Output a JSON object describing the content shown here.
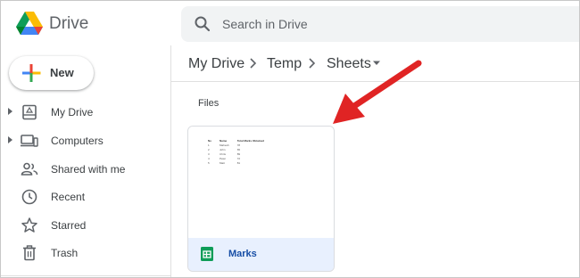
{
  "app": {
    "name": "Drive"
  },
  "search": {
    "placeholder": "Search in Drive"
  },
  "new_button": {
    "label": "New"
  },
  "sidebar": {
    "items": [
      {
        "label": "My Drive",
        "icon": "my-drive-icon",
        "expandable": true
      },
      {
        "label": "Computers",
        "icon": "computer-icon",
        "expandable": true
      },
      {
        "label": "Shared with me",
        "icon": "people-icon",
        "expandable": false
      },
      {
        "label": "Recent",
        "icon": "clock-icon",
        "expandable": false
      },
      {
        "label": "Starred",
        "icon": "star-icon",
        "expandable": false
      },
      {
        "label": "Trash",
        "icon": "trash-icon",
        "expandable": false
      }
    ]
  },
  "breadcrumb": [
    "My Drive",
    "Temp",
    "Sheets"
  ],
  "files_heading": "Files",
  "files": [
    {
      "name": "Marks",
      "type_icon": "google-sheets-icon",
      "preview": {
        "headers": [
          "No",
          "Name",
          "Total Marks Obtained"
        ],
        "rows": [
          [
            "1",
            "Mahesh",
            "78"
          ],
          [
            "2",
            "John",
            "65"
          ],
          [
            "3",
            "Chris",
            "89"
          ],
          [
            "4",
            "Peter",
            "72"
          ],
          [
            "5",
            "Matt",
            "81"
          ]
        ]
      }
    }
  ],
  "colors": {
    "sheets_green": "#0f9d58",
    "accent_red": "#e02424",
    "selected_card": "#e8f0fe"
  }
}
